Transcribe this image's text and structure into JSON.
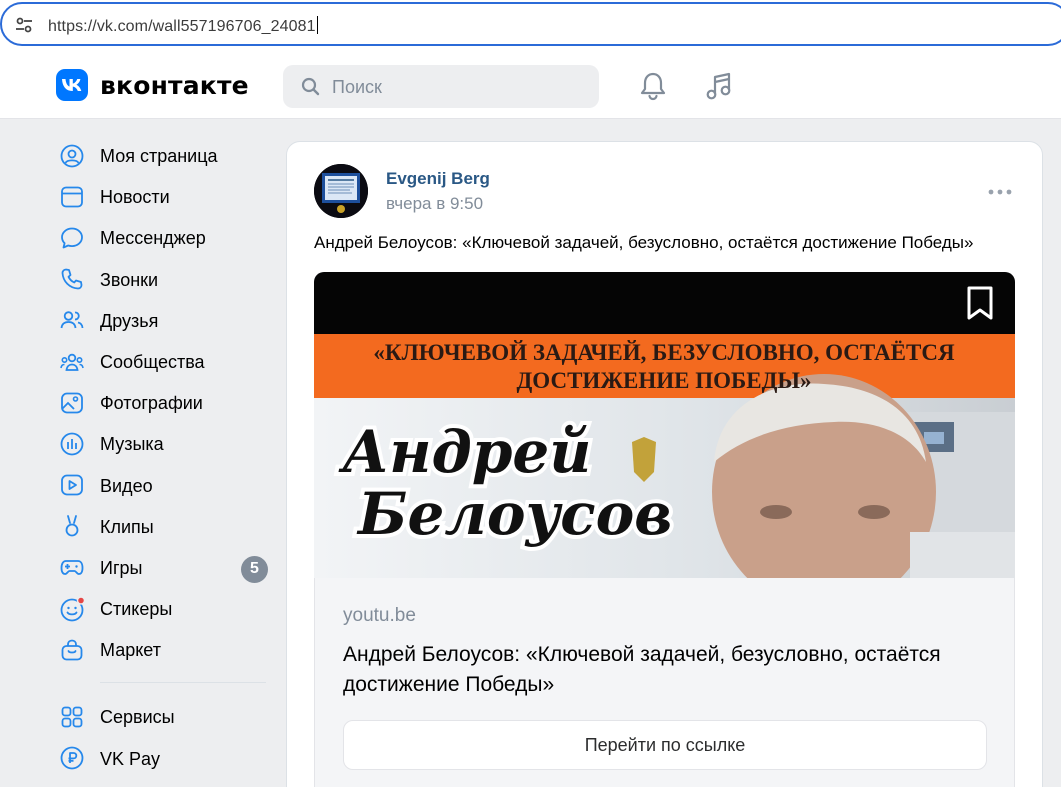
{
  "browser": {
    "url": "https://vk.com/wall557196706_24081"
  },
  "header": {
    "logo_text": "вконтакте",
    "search_placeholder": "Поиск"
  },
  "sidebar": {
    "items": [
      {
        "label": "Моя страница",
        "icon": "user-circle-icon"
      },
      {
        "label": "Новости",
        "icon": "news-icon"
      },
      {
        "label": "Мессенджер",
        "icon": "message-icon"
      },
      {
        "label": "Звонки",
        "icon": "phone-icon"
      },
      {
        "label": "Друзья",
        "icon": "friends-icon"
      },
      {
        "label": "Сообщества",
        "icon": "communities-icon"
      },
      {
        "label": "Фотографии",
        "icon": "photo-icon"
      },
      {
        "label": "Музыка",
        "icon": "music-bars-icon"
      },
      {
        "label": "Видео",
        "icon": "video-icon"
      },
      {
        "label": "Клипы",
        "icon": "clips-icon"
      },
      {
        "label": "Игры",
        "icon": "gamepad-icon",
        "badge": "5"
      },
      {
        "label": "Стикеры",
        "icon": "sticker-icon"
      },
      {
        "label": "Маркет",
        "icon": "market-bag-icon"
      }
    ],
    "items2": [
      {
        "label": "Сервисы",
        "icon": "services-icon"
      },
      {
        "label": "VK Pay",
        "icon": "vkpay-icon"
      }
    ]
  },
  "post": {
    "author": "Evgenij Berg",
    "time": "вчера в 9:50",
    "text": "Андрей Белоусов: «Ключевой задачей, безусловно, остаётся достижение Победы»",
    "thumbnail": {
      "banner_line1": "«КЛЮЧЕВОЙ ЗАДАЧЕЙ, БЕЗУСЛОВНО, ОСТАЁТСЯ",
      "banner_line2": "ДОСТИЖЕНИЕ ПОБЕДЫ»",
      "name_line1": "Андрей",
      "name_line2": "Белоусов"
    },
    "link": {
      "domain": "youtu.be",
      "title": "Андрей Белоусов: «Ключевой задачей, безусловно, остаётся достижение Победы»",
      "button": "Перейти по ссылке"
    }
  },
  "colors": {
    "accent": "#0077ff",
    "author_link": "#2a5885",
    "sidebar_icon": "#2688eb",
    "muted": "#818c99"
  }
}
